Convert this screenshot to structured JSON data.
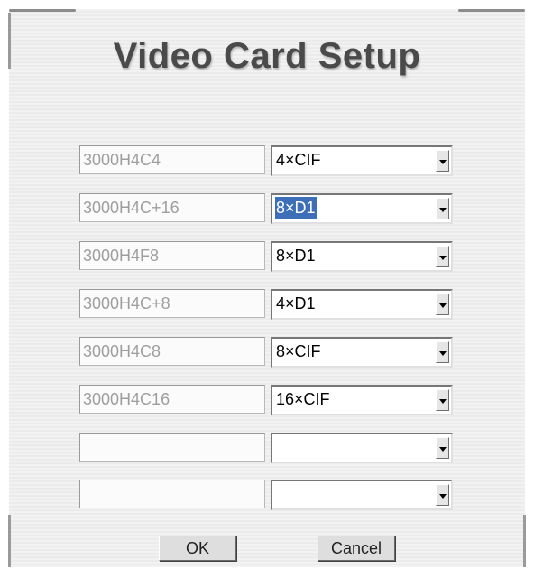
{
  "dialog": {
    "title": "Video Card Setup"
  },
  "rows": [
    {
      "model": "3000H4C4",
      "mode": "4×CIF",
      "selected": false
    },
    {
      "model": "3000H4C+16",
      "mode": "8×D1",
      "selected": true
    },
    {
      "model": "3000H4F8",
      "mode": "8×D1",
      "selected": false
    },
    {
      "model": "3000H4C+8",
      "mode": "4×D1",
      "selected": false
    },
    {
      "model": "3000H4C8",
      "mode": "8×CIF",
      "selected": false
    },
    {
      "model": "3000H4C16",
      "mode": "16×CIF",
      "selected": false
    },
    {
      "model": "",
      "mode": "",
      "selected": false
    },
    {
      "model": "",
      "mode": "",
      "selected": false
    }
  ],
  "buttons": {
    "ok_label": "OK",
    "cancel_label": "Cancel"
  },
  "colors": {
    "selection": "#3d6fb8",
    "title_text": "#4a4a4a",
    "disabled_text": "#9e9e9e"
  }
}
